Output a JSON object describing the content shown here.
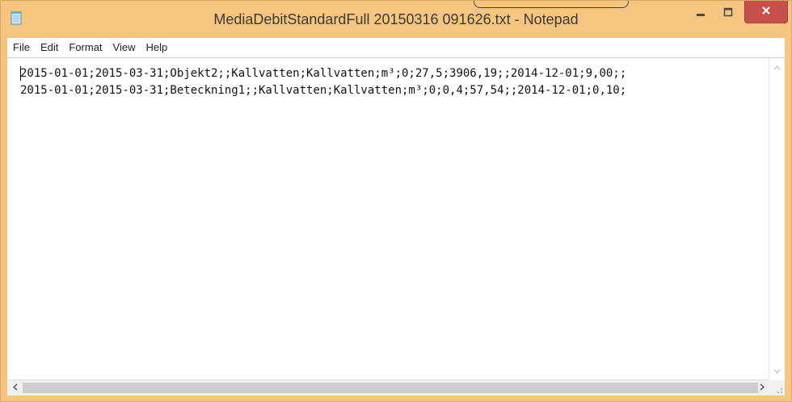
{
  "window": {
    "title": "MediaDebitStandardFull 20150316 091626.txt - Notepad",
    "app_icon": "notepad-icon",
    "controls": {
      "minimize_icon": "minimize-icon",
      "maximize_icon": "maximize-icon",
      "close_icon": "close-icon"
    }
  },
  "menubar": {
    "items": [
      "File",
      "Edit",
      "Format",
      "View",
      "Help"
    ]
  },
  "editor": {
    "lines": [
      "2015-01-01;2015-03-31;Objekt2;;Kallvatten;Kallvatten;m³;0;27,5;3906,19;;2014-12-01;9,00;;",
      "2015-01-01;2015-03-31;Beteckning1;;Kallvatten;Kallvatten;m³;0;0,4;57,54;;2014-12-01;0,10;"
    ]
  },
  "scrollbars": {
    "up_icon": "scroll-up-arrow-icon",
    "down_icon": "scroll-down-arrow-icon",
    "left_icon": "scroll-left-arrow-icon",
    "right_icon": "scroll-right-arrow-icon"
  },
  "colors": {
    "titlebar": "#f6c57f",
    "close_button": "#c7504b",
    "window_border": "#d9a766"
  }
}
